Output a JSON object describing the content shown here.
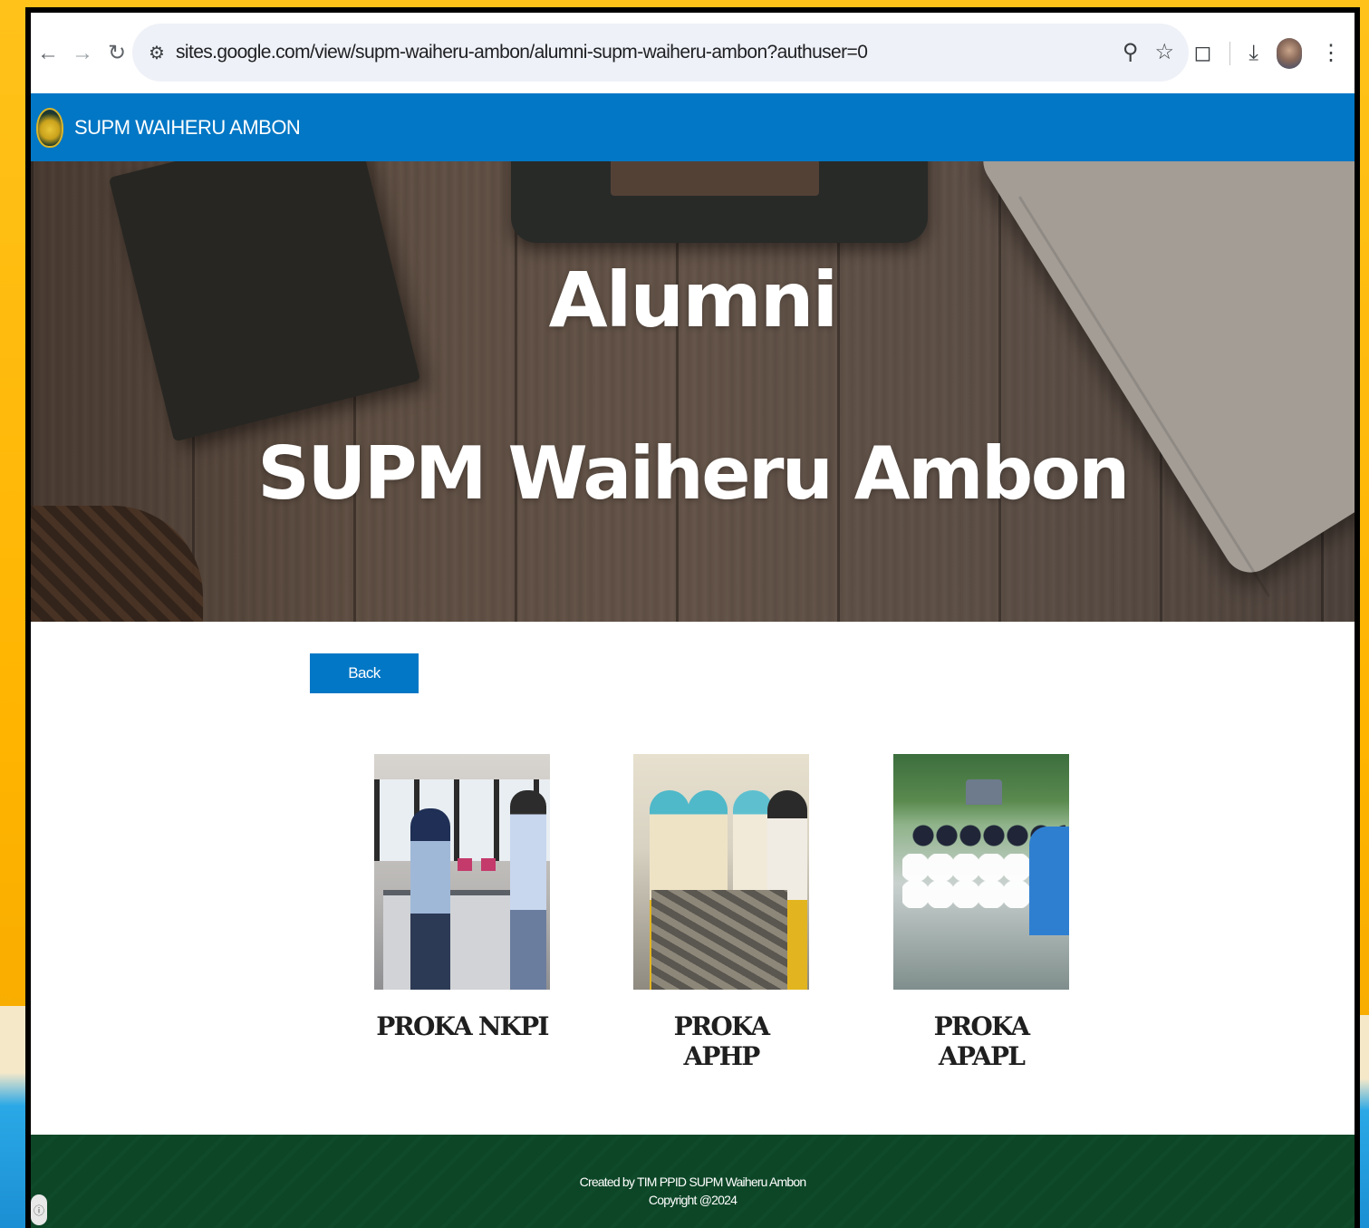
{
  "browser": {
    "url": "sites.google.com/view/supm-waiheru-ambon/alumni-supm-waiheru-ambon?authuser=0",
    "icons": [
      "back-arrow-icon",
      "forward-arrow-icon",
      "reload-icon",
      "site-settings-icon",
      "zoom-icon",
      "bookmark-star-icon",
      "extensions-icon",
      "download-icon",
      "profile-avatar",
      "more-menu-icon"
    ]
  },
  "site": {
    "name": "SUPM WAIHERU AMBON"
  },
  "hero": {
    "title": "Alumni",
    "subtitle": "SUPM Waiheru Ambon"
  },
  "content": {
    "back_label": "Back",
    "programs": [
      {
        "caption": "PROKA NKPI"
      },
      {
        "caption": "PROKA APHP"
      },
      {
        "caption": "PROKA APAPL"
      }
    ]
  },
  "footer": {
    "line1": "Created by TIM PPID SUPM Waiheru Ambon",
    "line2": "Copyright @2024"
  },
  "colors": {
    "header_blue": "#0277c5",
    "footer_green": "#0d4627",
    "frame_yellow": "#ffb400"
  }
}
